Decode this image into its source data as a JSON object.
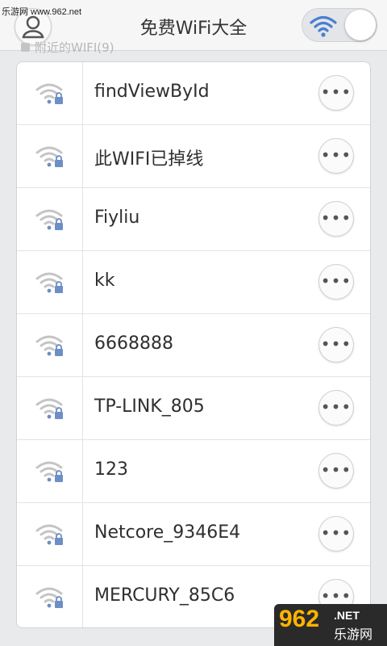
{
  "watermark": "乐游网 www.962.net",
  "header": {
    "title": "免费WiFi大全"
  },
  "section": {
    "label": "附近的WIFI(9)"
  },
  "networks": [
    {
      "name": "findViewById",
      "more": "•••"
    },
    {
      "name": "此WIFI已掉线",
      "more": "•••"
    },
    {
      "name": "Fiyliu",
      "more": "•••"
    },
    {
      "name": "kk",
      "more": "•••"
    },
    {
      "name": "6668888",
      "more": "•••"
    },
    {
      "name": "TP-LINK_805",
      "more": "•••"
    },
    {
      "name": "123",
      "more": "•••"
    },
    {
      "name": "Netcore_9346E4",
      "more": "•••"
    },
    {
      "name": "MERCURY_85C6",
      "more": "•••"
    }
  ],
  "logo": {
    "number": "962",
    "net": ".NET",
    "cn": "乐游网"
  },
  "colors": {
    "wifi_gray": "#c4c4c4",
    "lock_blue": "#6e8ec6",
    "toggle_wifi": "#4a7fd0"
  }
}
